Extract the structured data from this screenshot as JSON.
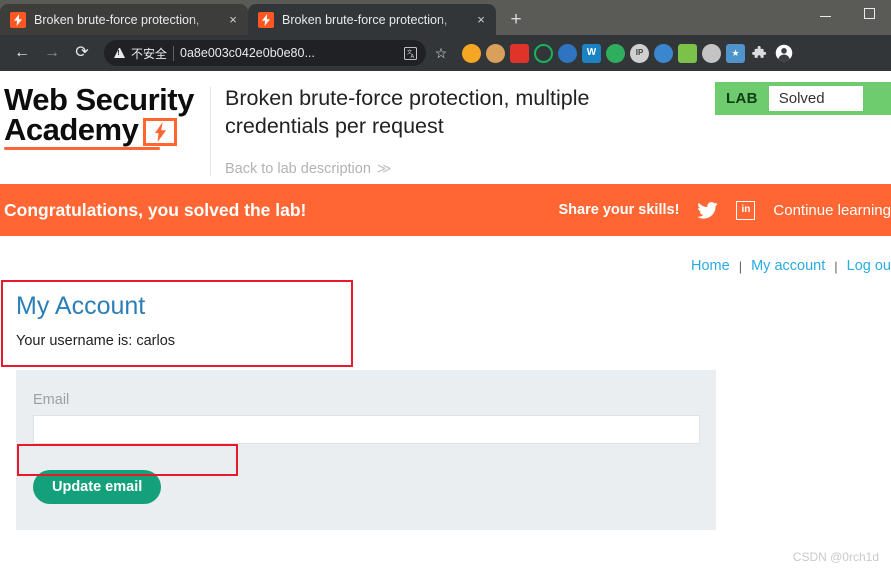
{
  "browser": {
    "tabs": [
      {
        "title": "Broken brute-force protection,",
        "favicon": "burp-bolt-icon",
        "active": false,
        "close_label": "×"
      },
      {
        "title": "Broken brute-force protection,",
        "favicon": "burp-bolt-icon",
        "active": true,
        "close_label": "×"
      }
    ],
    "new_tab_label": "+",
    "window_controls": {
      "minimize": "minimize-icon",
      "maximize": "maximize-icon"
    },
    "toolbar": {
      "back": "←",
      "forward": "→",
      "reload": "⟳",
      "security_warning": "不安全",
      "url": "0a8e003c042e0b0e80...",
      "translate_icon": "translate-icon",
      "bookmark_star": "☆"
    },
    "extensions": [
      {
        "name": "orange-circle-extension",
        "color": "#f5a623",
        "glyph": ""
      },
      {
        "name": "cookie-extension",
        "color": "#d9a05b",
        "glyph": ""
      },
      {
        "name": "dice-extension",
        "color": "#e0342b",
        "glyph": ""
      },
      {
        "name": "gear-green-extension",
        "color": "#19b35c",
        "glyph": ""
      },
      {
        "name": "paint-extension",
        "color": "#2f74c0",
        "glyph": ""
      },
      {
        "name": "wappalyzer-extension",
        "color": "#1b82c4",
        "glyph": "W"
      },
      {
        "name": "globe-green-extension",
        "color": "#2fae5d",
        "glyph": ""
      },
      {
        "name": "ip-lookup-extension",
        "color": "#d0d0d0",
        "glyph": "IP"
      },
      {
        "name": "globe-blue-extension",
        "color": "#3a87d0",
        "glyph": ""
      },
      {
        "name": "qr-code-extension",
        "color": "#7cc24a",
        "glyph": ""
      },
      {
        "name": "cloud-gray-extension",
        "color": "#c4c4c4",
        "glyph": ""
      },
      {
        "name": "star-blue-extension",
        "color": "#4f94cd",
        "glyph": "★"
      },
      {
        "name": "extensions-puzzle-icon",
        "color": "#transparent",
        "glyph": "🧩"
      },
      {
        "name": "profile-avatar-icon",
        "color": "#ffffff",
        "glyph": "👤"
      }
    ]
  },
  "site": {
    "logo": {
      "line1": "Web Security",
      "line2": "Academy",
      "bolt": "⚡"
    },
    "lab_title": "Broken brute-force protection, multiple credentials per request",
    "back_link": "Back to lab description",
    "back_chevron": "≫",
    "badge": {
      "tag": "LAB",
      "status": "Solved"
    }
  },
  "banner": {
    "message": "Congratulations, you solved the lab!",
    "share_label": "Share your skills!",
    "twitter_icon": "twitter-bird-icon",
    "linkedin_icon": "linkedin-icon",
    "linkedin_glyph": "in",
    "continue_link": "Continue learning"
  },
  "nav": {
    "links": [
      "Home",
      "My account",
      "Log ou"
    ],
    "separator": "|"
  },
  "account": {
    "heading": "My Account",
    "username_line": "Your username is: carlos",
    "email_label": "Email",
    "email_value": "",
    "email_placeholder": "",
    "update_button": "Update email"
  },
  "watermark": "CSDN @0rch1d",
  "colors": {
    "brand_orange": "#ff6633",
    "badge_green": "#6ecc6e",
    "link_blue": "#29abe2",
    "heading_blue": "#2a7fb8",
    "button_teal": "#14a07a",
    "annotation_red": "#e8192c",
    "panel_gray": "#eaeef0"
  }
}
